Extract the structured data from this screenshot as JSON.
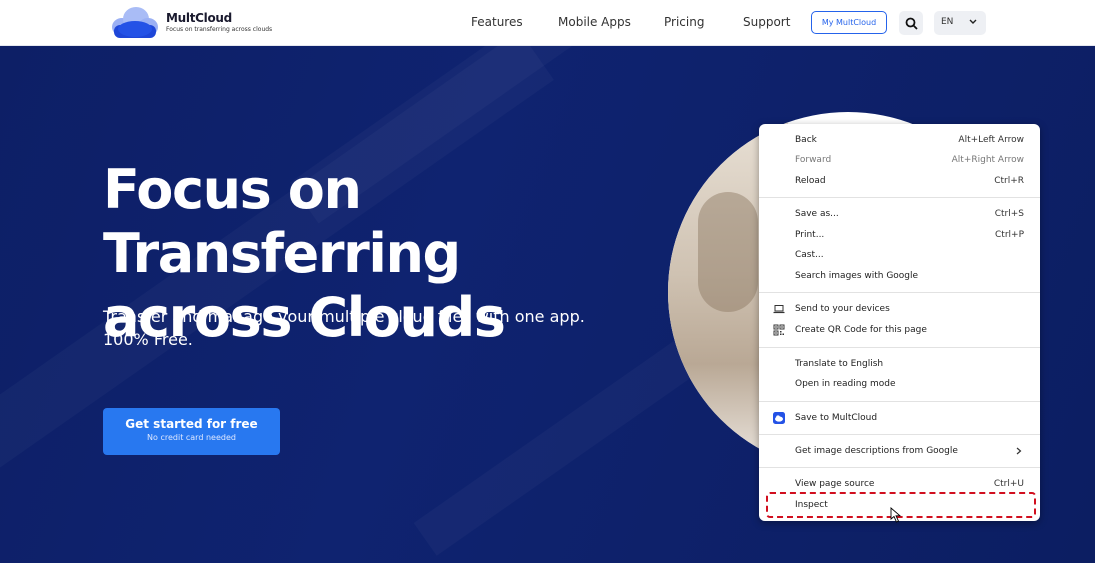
{
  "brand": {
    "name": "MultCloud",
    "tagline": "Focus on transferring across clouds",
    "color": "#2563eb"
  },
  "nav": {
    "items": [
      "Features",
      "Mobile Apps",
      "Pricing",
      "Support"
    ],
    "my_button": "My MultCloud",
    "search_icon": "search-icon",
    "language": "EN"
  },
  "hero": {
    "title_line1": "Focus on Transferring",
    "title_line2": "across Clouds",
    "subtitle_line1": "Transfer and manage your multiple cloud files with one app.",
    "subtitle_line2": "100% Free.",
    "cta_label": "Get started for free",
    "cta_note": "No credit card needed",
    "background_color": "#0d1f66",
    "cta_color": "#2878f0"
  },
  "context_menu": {
    "items": [
      {
        "label": "Back",
        "shortcut": "Alt+Left Arrow"
      },
      {
        "label": "Forward",
        "shortcut": "Alt+Right Arrow",
        "disabled": true
      },
      {
        "label": "Reload",
        "shortcut": "Ctrl+R"
      },
      {
        "label": "Save as...",
        "shortcut": "Ctrl+S"
      },
      {
        "label": "Print...",
        "shortcut": "Ctrl+P"
      },
      {
        "label": "Cast..."
      },
      {
        "label": "Search images with Google"
      },
      {
        "label": "Send to your devices",
        "icon": "laptop-icon"
      },
      {
        "label": "Create QR Code for this page",
        "icon": "qr-code-icon"
      },
      {
        "label": "Translate to English"
      },
      {
        "label": "Open in reading mode"
      },
      {
        "label": "Save to MultCloud",
        "icon": "multcloud-icon"
      },
      {
        "label": "Get image descriptions from Google",
        "submenu": true
      },
      {
        "label": "View page source",
        "shortcut": "Ctrl+U"
      },
      {
        "label": "Inspect",
        "highlighted": true
      }
    ],
    "highlight_color": "#d10f1f"
  }
}
